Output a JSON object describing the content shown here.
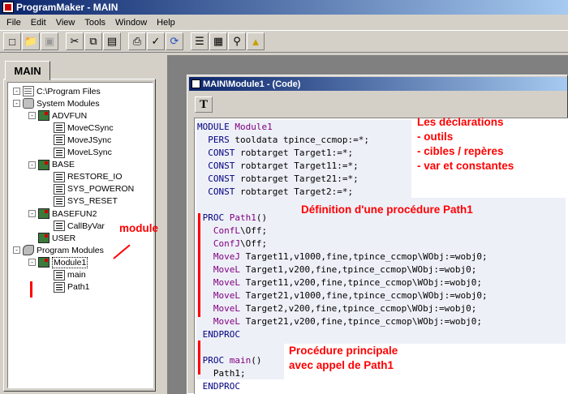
{
  "window": {
    "title": "ProgramMaker - MAIN"
  },
  "menu": [
    "File",
    "Edit",
    "View",
    "Tools",
    "Window",
    "Help"
  ],
  "toolbar": {
    "buttons": [
      "new-icon",
      "open-icon",
      "save-icon",
      "cut-icon",
      "copy-icon",
      "paste-icon",
      "print-icon",
      "check-icon",
      "refresh-icon",
      "list-icon",
      "table-icon",
      "find-icon",
      "cube-icon"
    ]
  },
  "left_panel": {
    "tab_label": "MAIN",
    "tree": [
      {
        "label": "C:\\Program Files",
        "level": 0,
        "toggle": "-",
        "icon": "folder"
      },
      {
        "label": "System Modules",
        "level": 0,
        "toggle": "-",
        "icon": "sys"
      },
      {
        "label": "ADVFUN",
        "level": 1,
        "toggle": "-",
        "icon": "mod"
      },
      {
        "label": "MoveCSync",
        "level": 2,
        "toggle": "",
        "icon": "proc"
      },
      {
        "label": "MoveJSync",
        "level": 2,
        "toggle": "",
        "icon": "proc"
      },
      {
        "label": "MoveLSync",
        "level": 2,
        "toggle": "",
        "icon": "proc"
      },
      {
        "label": "BASE",
        "level": 1,
        "toggle": "-",
        "icon": "mod"
      },
      {
        "label": "RESTORE_IO",
        "level": 2,
        "toggle": "",
        "icon": "proc"
      },
      {
        "label": "SYS_POWERON",
        "level": 2,
        "toggle": "",
        "icon": "proc"
      },
      {
        "label": "SYS_RESET",
        "level": 2,
        "toggle": "",
        "icon": "proc"
      },
      {
        "label": "BASEFUN2",
        "level": 1,
        "toggle": "-",
        "icon": "mod"
      },
      {
        "label": "CallByVar",
        "level": 2,
        "toggle": "",
        "icon": "proc"
      },
      {
        "label": "USER",
        "level": 1,
        "toggle": "",
        "icon": "mod"
      },
      {
        "label": "Program Modules",
        "level": 0,
        "toggle": "-",
        "icon": "pm"
      },
      {
        "label": "Module1",
        "level": 1,
        "toggle": "-",
        "icon": "mod",
        "selected": true
      },
      {
        "label": "main",
        "level": 2,
        "toggle": "",
        "icon": "proc"
      },
      {
        "label": "Path1",
        "level": 2,
        "toggle": "",
        "icon": "proc"
      }
    ]
  },
  "code_window": {
    "title": "MAIN\\Module1 - (Code)",
    "format_button": "T",
    "lines": [
      [
        [
          "kw",
          "MODULE "
        ],
        [
          "id",
          "Module1"
        ]
      ],
      [
        [
          "op",
          "  "
        ],
        [
          "kw",
          "PERS "
        ],
        [
          "op",
          "tooldata tpince_ccmop:=*;"
        ]
      ],
      [
        [
          "op",
          "  "
        ],
        [
          "kw",
          "CONST "
        ],
        [
          "op",
          "robtarget Target1:=*;"
        ]
      ],
      [
        [
          "op",
          "  "
        ],
        [
          "kw",
          "CONST "
        ],
        [
          "op",
          "robtarget Target11:=*;"
        ]
      ],
      [
        [
          "op",
          "  "
        ],
        [
          "kw",
          "CONST "
        ],
        [
          "op",
          "robtarget Target21:=*;"
        ]
      ],
      [
        [
          "op",
          "  "
        ],
        [
          "kw",
          "CONST "
        ],
        [
          "op",
          "robtarget Target2:=*;"
        ]
      ],
      [
        [
          "op",
          ""
        ]
      ],
      [
        [
          "op",
          " "
        ],
        [
          "kw",
          "PROC "
        ],
        [
          "id",
          "Path1"
        ],
        [
          "op",
          "()"
        ]
      ],
      [
        [
          "op",
          "   "
        ],
        [
          "id",
          "ConfL"
        ],
        [
          "op",
          "\\Off;"
        ]
      ],
      [
        [
          "op",
          "   "
        ],
        [
          "id",
          "ConfJ"
        ],
        [
          "op",
          "\\Off;"
        ]
      ],
      [
        [
          "op",
          "   "
        ],
        [
          "id",
          "MoveJ "
        ],
        [
          "op",
          "Target11,v1000,fine,tpince_ccmop\\WObj:=wobj0;"
        ]
      ],
      [
        [
          "op",
          "   "
        ],
        [
          "id",
          "MoveL "
        ],
        [
          "op",
          "Target1,v200,fine,tpince_ccmop\\WObj:=wobj0;"
        ]
      ],
      [
        [
          "op",
          "   "
        ],
        [
          "id",
          "MoveL "
        ],
        [
          "op",
          "Target11,v200,fine,tpince_ccmop\\WObj:=wobj0;"
        ]
      ],
      [
        [
          "op",
          "   "
        ],
        [
          "id",
          "MoveL "
        ],
        [
          "op",
          "Target21,v1000,fine,tpince_ccmop\\WObj:=wobj0;"
        ]
      ],
      [
        [
          "op",
          "   "
        ],
        [
          "id",
          "MoveL "
        ],
        [
          "op",
          "Target2,v200,fine,tpince_ccmop\\WObj:=wobj0;"
        ]
      ],
      [
        [
          "op",
          "   "
        ],
        [
          "id",
          "MoveL "
        ],
        [
          "op",
          "Target21,v200,fine,tpince_ccmop\\WObj:=wobj0;"
        ]
      ],
      [
        [
          "op",
          " "
        ],
        [
          "kw",
          "ENDPROC"
        ]
      ],
      [
        [
          "op",
          ""
        ]
      ],
      [
        [
          "op",
          " "
        ],
        [
          "kw",
          "PROC "
        ],
        [
          "id",
          "main"
        ],
        [
          "op",
          "()"
        ]
      ],
      [
        [
          "op",
          "   "
        ],
        [
          "op",
          "Path1;"
        ]
      ],
      [
        [
          "op",
          " "
        ],
        [
          "kw",
          "ENDPROC"
        ]
      ]
    ]
  },
  "annotations": {
    "declarations": [
      "Les déclarations",
      "- outils",
      "- cibles / repères",
      "- var et constantes"
    ],
    "proc_def": "Définition d'une procédure Path1",
    "main_proc": [
      "Procédure principale",
      "avec appel de Path1"
    ],
    "module": "module"
  },
  "colors": {
    "annotation": "#ff0000",
    "keyword": "#000080",
    "identifier": "#800080",
    "title_bar": "#0a246a"
  }
}
